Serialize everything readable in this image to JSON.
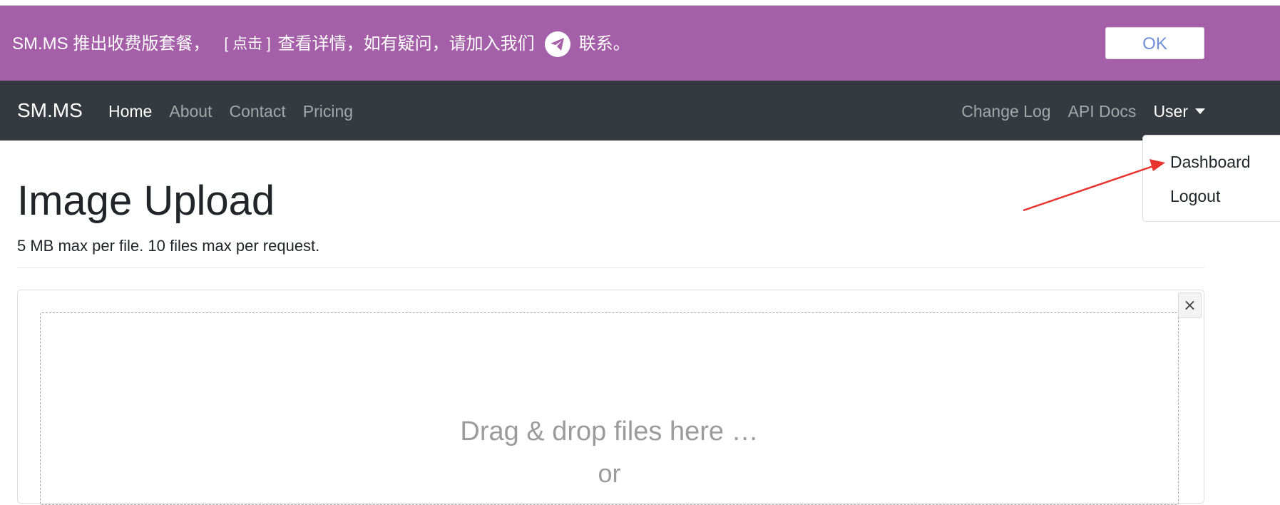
{
  "banner": {
    "text_before": "SM.MS 推出收费版套餐，",
    "link_label": "[ 点击 ]",
    "text_middle": "查看详情，如有疑问，请加入我们",
    "telegram_icon": "telegram-icon",
    "text_after": "联系。",
    "ok_label": "OK",
    "background": "#a45fa8"
  },
  "navbar": {
    "brand": "SM.MS",
    "left_links": [
      "Home",
      "About",
      "Contact",
      "Pricing"
    ],
    "active": "Home",
    "right_links": [
      "Change Log",
      "API Docs"
    ],
    "user_label": "User",
    "background": "#343a40"
  },
  "dropdown": {
    "items": [
      "Dashboard",
      "Logout"
    ]
  },
  "main": {
    "title": "Image Upload",
    "subtitle": "5 MB max per file. 10 files max per request.",
    "close_label": "×",
    "drop_text": "Drag & drop files here …",
    "or_text": "or"
  },
  "annotation": {
    "color": "#e8322d"
  }
}
